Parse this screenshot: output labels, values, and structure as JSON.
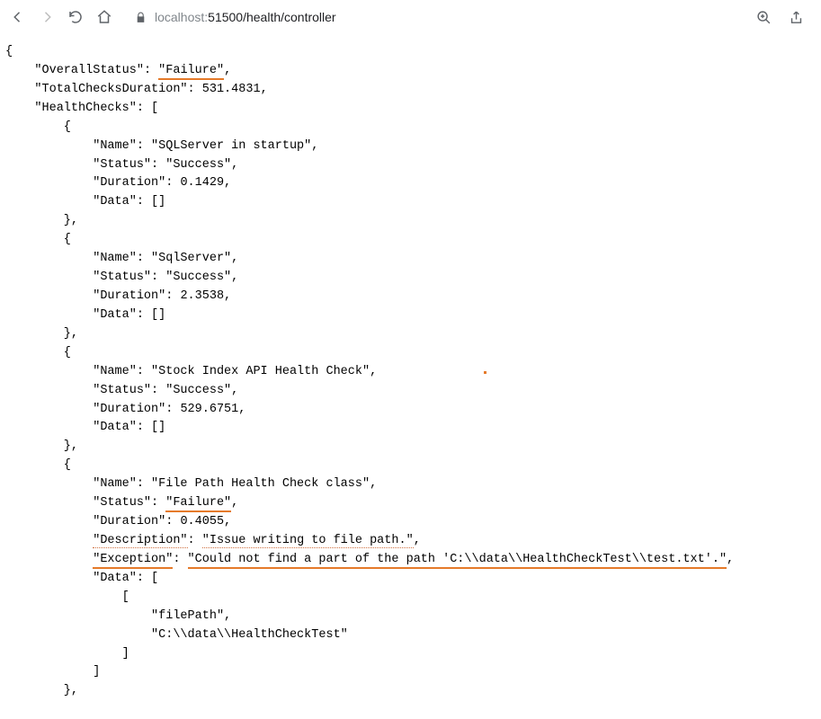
{
  "address": {
    "host": "localhost:",
    "path": "51500/health/controller"
  },
  "json": {
    "overallStatusKey": "\"OverallStatus\"",
    "overallStatusVal": "\"Failure\"",
    "totalChecksKey": "\"TotalChecksDuration\"",
    "totalChecksVal": "531.4831",
    "healthChecksKey": "\"HealthChecks\"",
    "c1": {
      "nameKey": "\"Name\"",
      "nameVal": "\"SQLServer in startup\"",
      "statusKey": "\"Status\"",
      "statusVal": "\"Success\"",
      "durKey": "\"Duration\"",
      "durVal": "0.1429",
      "dataKey": "\"Data\"",
      "dataVal": "[]"
    },
    "c2": {
      "nameKey": "\"Name\"",
      "nameVal": "\"SqlServer\"",
      "statusKey": "\"Status\"",
      "statusVal": "\"Success\"",
      "durKey": "\"Duration\"",
      "durVal": "2.3538",
      "dataKey": "\"Data\"",
      "dataVal": "[]"
    },
    "c3": {
      "nameKey": "\"Name\"",
      "nameVal": "\"Stock Index API Health Check\"",
      "statusKey": "\"Status\"",
      "statusVal": "\"Success\"",
      "durKey": "\"Duration\"",
      "durVal": "529.6751",
      "dataKey": "\"Data\"",
      "dataVal": "[]"
    },
    "c4": {
      "nameKey": "\"Name\"",
      "nameVal": "\"File Path Health Check class\"",
      "statusKey": "\"Status\"",
      "statusVal": "\"Failure\"",
      "durKey": "\"Duration\"",
      "durVal": "0.4055",
      "descKey": "\"Description\"",
      "descVal": "\"Issue writing to file path.\"",
      "excKey": "\"Exception\"",
      "excVal": "\"Could not find a part of the path 'C:\\\\data\\\\HealthCheckTest\\\\test.txt'.\"",
      "dataKey": "\"Data\"",
      "dLine1": "\"filePath\"",
      "dLine2": "\"C:\\\\data\\\\HealthCheckTest\""
    }
  }
}
